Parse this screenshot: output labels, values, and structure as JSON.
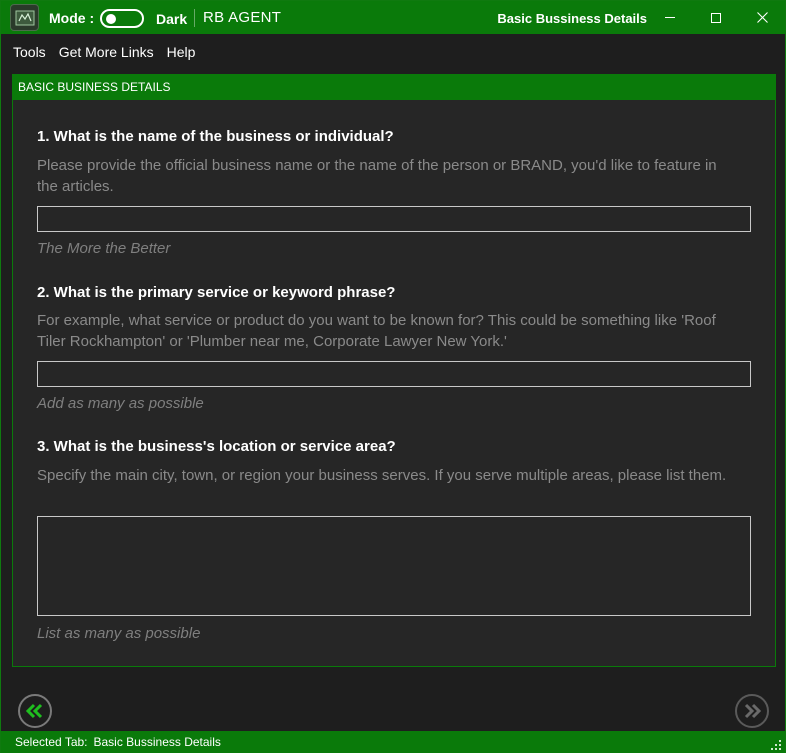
{
  "titlebar": {
    "mode_label": "Mode :",
    "theme_label": "Dark",
    "app_name": "RB AGENT",
    "window_title": "Basic Bussiness Details"
  },
  "menu": {
    "items": [
      "Tools",
      "Get More Links",
      "Help"
    ]
  },
  "panel": {
    "header": "BASIC BUSINESS DETAILS",
    "questions": [
      {
        "title": "1.  What is the name of the business or individual?",
        "description": "Please provide the official business name or the name of the person or BRAND, you'd like to feature in the articles.",
        "value": "",
        "hint": "The More the Better"
      },
      {
        "title": "2.  What is the primary service or keyword phrase?",
        "description": "For example, what service or product do you want to be known for? This could be something like 'Roof Tiler Rockhampton' or 'Plumber near me, Corporate Lawyer New York.'",
        "value": "",
        "hint": "Add as many as possible"
      },
      {
        "title": "3.  What is the business's location or service area?",
        "description": "Specify the main city, town, or region your business serves. If you serve multiple areas, please list them.",
        "value": "",
        "hint": "List as many as possible"
      }
    ]
  },
  "navigation": {
    "prev_icon": "double-chevron-left-icon",
    "next_icon": "double-chevron-right-icon"
  },
  "status": {
    "label": "Selected Tab:",
    "value": "Basic Bussiness Details"
  },
  "colors": {
    "accent": "#0a7a0a",
    "background": "#1e1e1e",
    "panel": "#262626",
    "muted_text": "#8a8a8a"
  }
}
